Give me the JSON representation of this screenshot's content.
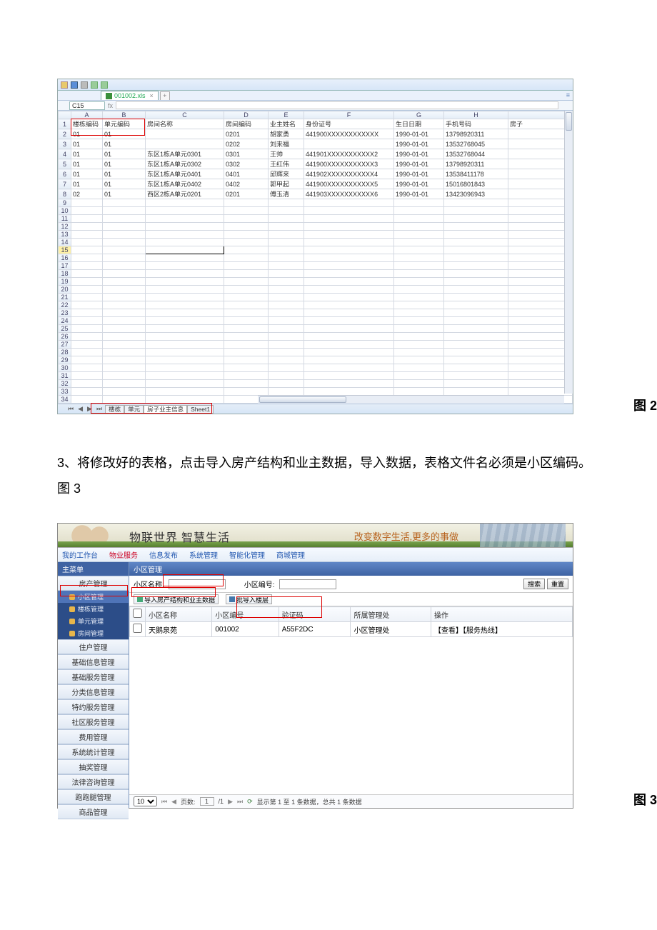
{
  "fig2": {
    "label": "图 2",
    "doc_tab": "001002.xls",
    "cell_name": "C15",
    "cols": [
      "A",
      "B",
      "C",
      "D",
      "E",
      "F",
      "G",
      "H",
      ""
    ],
    "headers": [
      "楼栋编码",
      "单元编码",
      "房间名称",
      "房间编码",
      "业主姓名",
      "身份证号",
      "生日日期",
      "手机号码",
      "房子"
    ],
    "rows": [
      [
        "01",
        "01",
        "",
        "0201",
        "胡家勇",
        "441900XXXXXXXXXXXX",
        "1990-01-01",
        "13798920311",
        ""
      ],
      [
        "01",
        "01",
        "",
        "0202",
        "刘来福",
        "",
        "1990-01-01",
        "13532768045",
        ""
      ],
      [
        "01",
        "01",
        "东区1栋A单元0301",
        "0301",
        "王帅",
        "441901XXXXXXXXXXX2",
        "1990-01-01",
        "13532768044",
        ""
      ],
      [
        "01",
        "01",
        "东区1栋A单元0302",
        "0302",
        "王红伟",
        "441900XXXXXXXXXXX3",
        "1990-01-01",
        "13798920311",
        ""
      ],
      [
        "01",
        "01",
        "东区1栋A单元0401",
        "0401",
        "邱辉来",
        "441902XXXXXXXXXXX4",
        "1990-01-01",
        "13538411178",
        ""
      ],
      [
        "01",
        "01",
        "东区1栋A单元0402",
        "0402",
        "郭甲起",
        "441900XXXXXXXXXXX5",
        "1990-01-01",
        "15016801843",
        ""
      ],
      [
        "02",
        "01",
        "西区2栋A单元0201",
        "0201",
        "傅玉清",
        "441903XXXXXXXXXXX6",
        "1990-01-01",
        "13423096943",
        ""
      ]
    ],
    "blank_rows": 26,
    "sheet_tabs": [
      "楼栋",
      "单元",
      "房子业主信息",
      "Sheet1"
    ]
  },
  "paragraph": "3、将修改好的表格，点击导入房产结构和业主数据，导入数据，表格文件名必须是小区编码。图 3",
  "fig3": {
    "label": "图 3",
    "banner_slogan": "物联世界 智慧生活",
    "banner_right": "改变数字生活,更多的事做",
    "nav": {
      "items": [
        "我的工作台",
        "物业服务",
        "信息发布",
        "系统管理",
        "智能化管理",
        "商城管理"
      ],
      "active_idx": 1
    },
    "sidebar": {
      "title": "主菜单",
      "top_cat": "房产管理",
      "subs": [
        "小区管理",
        "楼栋管理",
        "单元管理",
        "房间管理"
      ],
      "active_sub_idx": 0,
      "cats": [
        "住户管理",
        "基础信息管理",
        "基础服务管理",
        "分类信息管理",
        "特约服务管理",
        "社区服务管理",
        "费用管理",
        "系统统计管理",
        "抽奖管理",
        "法律咨询管理",
        "跑跑腿管理",
        "商品管理"
      ]
    },
    "content": {
      "title": "小区管理",
      "search": {
        "name_lbl": "小区名称:",
        "code_lbl": "小区编号:",
        "btn_search": "搜索",
        "btn_reset": "重置"
      },
      "tools": {
        "import": "导入房产结构和业主数据",
        "batch": "批导入楼层"
      },
      "grid": {
        "headers": [
          "",
          "小区名称",
          "小区编号",
          "验证码",
          "所属管理处",
          "操作"
        ],
        "row": [
          "",
          "天鹅泉苑",
          "001002",
          "A55F2DC",
          "小区管理处",
          "【查看】【服务热线】"
        ]
      },
      "pager": {
        "size": "10",
        "page_lbl": "页数:",
        "page": "1",
        "total_pg": "/1",
        "info": "显示第 1 至 1 条数据，总共 1 条数据"
      }
    }
  }
}
